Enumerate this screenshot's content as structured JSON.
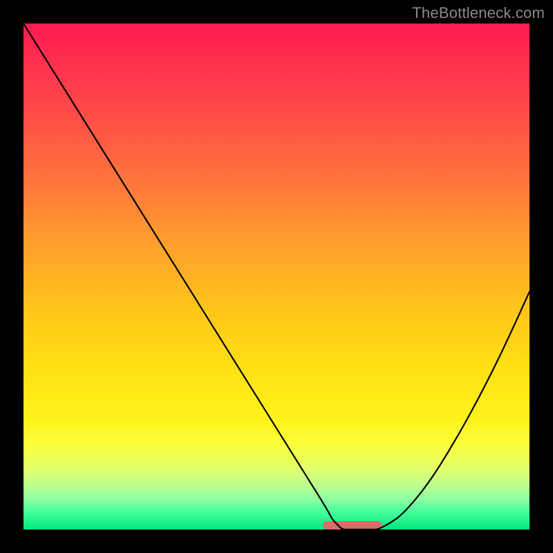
{
  "watermark": "TheBottleneck.com",
  "chart_data": {
    "type": "line",
    "title": "",
    "xlabel": "",
    "ylabel": "",
    "xlim": [
      0,
      100
    ],
    "ylim": [
      0,
      100
    ],
    "grid": false,
    "background_gradient": {
      "top": "#ff1a53",
      "middle": "#ffe013",
      "bottom": "#00e77f"
    },
    "series": [
      {
        "name": "bottleneck-curve",
        "x": [
          0,
          5,
          10,
          15,
          20,
          25,
          30,
          35,
          40,
          45,
          50,
          55,
          60,
          61,
          62,
          63,
          64,
          65,
          67,
          69,
          70,
          72,
          75,
          80,
          85,
          90,
          95,
          100
        ],
        "values": [
          100,
          92,
          84,
          76,
          68,
          60,
          52,
          44,
          36,
          28,
          20,
          12,
          4,
          2,
          1,
          0,
          0,
          0,
          0,
          0,
          0,
          1,
          3,
          9,
          17,
          26,
          36,
          47
        ]
      }
    ],
    "highlight_segment": {
      "name": "optimal-range",
      "x_start": 60,
      "x_end": 70,
      "y": 0,
      "color": "#dc6a68"
    }
  }
}
